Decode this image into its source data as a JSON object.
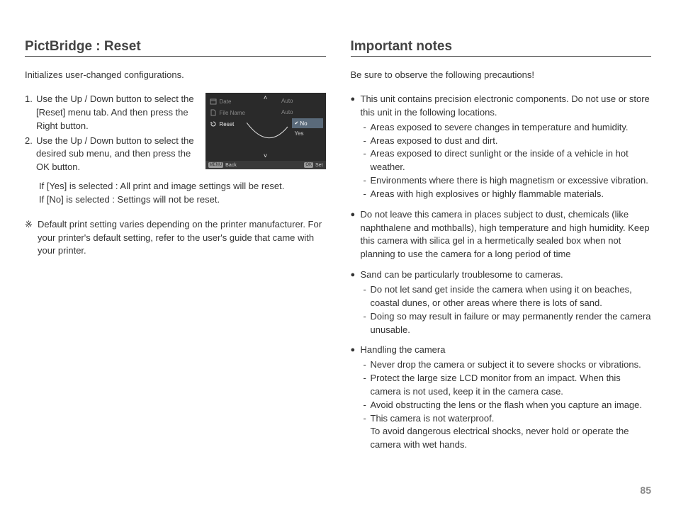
{
  "left": {
    "title": "PictBridge : Reset",
    "intro": "Initializes user-changed configurations.",
    "steps": [
      {
        "num": "1.",
        "text": "Use the Up / Down button to select the [Reset] menu tab. And then press the Right button."
      },
      {
        "num": "2.",
        "text": "Use the Up / Down button to select the desired sub menu, and then press the OK button."
      }
    ],
    "screen": {
      "menu": [
        {
          "icon": "calendar",
          "label": "Date",
          "value": "Auto"
        },
        {
          "icon": "file",
          "label": "File Name",
          "value": "Auto"
        },
        {
          "icon": "reset",
          "label": "Reset",
          "value": ""
        }
      ],
      "submenu": {
        "no": "No",
        "yes": "Yes"
      },
      "bar": {
        "backKey": "MENU",
        "back": "Back",
        "setKey": "OK",
        "set": "Set"
      }
    },
    "explain_yes": "If [Yes] is selected : All print and image settings will be reset.",
    "explain_no": "If [No] is selected  : Settings will not be reset.",
    "note_sym": "※",
    "note": "Default print setting varies depending on the printer manufacturer. For your printer's default setting, refer to the user's guide that came with your printer."
  },
  "right": {
    "title": "Important notes",
    "intro": "Be sure to observe the following precautions!",
    "bullets": [
      {
        "lead": "This unit contains precision electronic components. Do not use or store this unit in the following locations.",
        "subs": [
          "Areas exposed to severe changes in temperature and humidity.",
          "Areas exposed to dust and dirt.",
          "Areas exposed to direct sunlight or the inside of a vehicle in hot weather.",
          "Environments where there is high magnetism or excessive vibration.",
          "Areas with high explosives or highly flammable materials."
        ]
      },
      {
        "lead": "Do not leave this camera in places subject to dust, chemicals (like naphthalene and mothballs), high temperature and high humidity. Keep this camera with silica gel in a hermetically sealed box when not planning to use the camera for a long period of time",
        "subs": []
      },
      {
        "lead": "Sand can be particularly troublesome to cameras.",
        "subs": [
          "Do not let sand get inside the camera when using it on beaches, coastal dunes, or other areas where there is lots of sand.",
          "Doing so may result in failure or may permanently render the camera unusable."
        ]
      },
      {
        "lead": "Handling the camera",
        "subs": [
          "Never drop the camera or subject it to severe shocks or vibrations.",
          "Protect the large size LCD monitor from an impact. When this camera is not used, keep it in the camera case.",
          "Avoid obstructing the lens or the flash when you capture an image.",
          "This camera is not waterproof."
        ],
        "tail": "To avoid dangerous electrical shocks, never hold or operate the camera with wet hands."
      }
    ]
  },
  "page": "85"
}
